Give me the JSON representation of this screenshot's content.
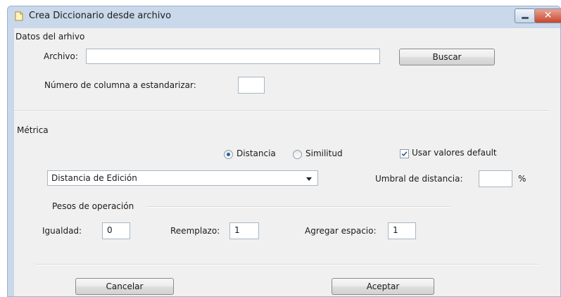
{
  "window": {
    "title": "Crea Diccionario desde archivo",
    "close_glyph": "✕",
    "icons": {
      "app": "document-icon",
      "minimize": "minimize-icon",
      "close": "close-icon"
    }
  },
  "datos": {
    "heading": "Datos del arhivo",
    "archivo_label": "Archivo:",
    "archivo_value": "",
    "buscar_label": "Buscar",
    "columna_label": "Número de columna a estandarizar:",
    "columna_value": ""
  },
  "metrica": {
    "heading": "Métrica",
    "radio_distancia": "Distancia",
    "radio_similitud": "Similitud",
    "selected_radio": "Distancia",
    "usar_default_label": "Usar valores default",
    "usar_default_checked": true,
    "metric_select_value": "Distancia de Edición",
    "umbral_label": "Umbral de  distancia:",
    "umbral_value": "",
    "percent": "%"
  },
  "pesos": {
    "heading": "Pesos de operación",
    "igualdad_label": "Igualdad:",
    "igualdad_value": "0",
    "reemplazo_label": "Reemplazo:",
    "reemplazo_value": "1",
    "agregar_label": "Agregar espacio:",
    "agregar_value": "1"
  },
  "footer": {
    "cancelar_label": "Cancelar",
    "aceptar_label": "Aceptar"
  }
}
